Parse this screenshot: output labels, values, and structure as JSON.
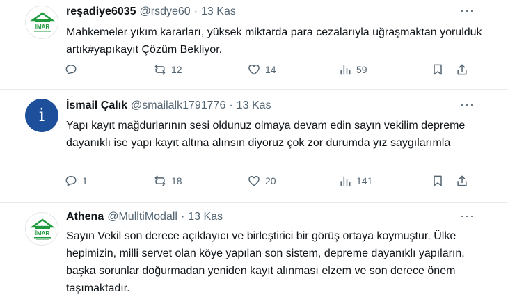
{
  "tweets": [
    {
      "name": "reşadiye6035",
      "handle": "@rsdye60",
      "separator": "·",
      "date": "13 Kas",
      "more": "···",
      "avatar_text": "İMAR",
      "text": "Mahkemeler yıkım kararları, yüksek miktarda para cezalarıyla uğraşmaktan yorulduk artık#yapıkayıt Çözüm Bekliyor.",
      "replies": "",
      "retweets": "12",
      "likes": "14",
      "views": "59"
    },
    {
      "name": "İsmail Çalık",
      "handle": "@smailalk1791776",
      "separator": "·",
      "date": "13 Kas",
      "more": "···",
      "avatar_text": "i",
      "text": "Yapı kayıt mağdurlarının sesi oldunuz olmaya devam edin sayın vekilim depreme dayanıklı ise yapı kayıt altına alınsın diyoruz çok zor durumda yız saygılarımla",
      "replies": "1",
      "retweets": "18",
      "likes": "20",
      "views": "141"
    },
    {
      "name": "Athena",
      "handle": "@MulltiModall",
      "separator": "·",
      "date": "13 Kas",
      "more": "···",
      "avatar_text": "İMAR",
      "text": "Sayın Vekil son derece açıklayıcı ve birleştirici bir görüş ortaya koymuştur. Ülke hepimizin, milli servet olan köye yapılan son sistem, depreme dayanıklı yapıların, başka sorunlar doğurmadan yeniden kayıt alınması elzem ve son derece önem taşımaktadır."
    }
  ],
  "colors": {
    "text": "#0f1419",
    "muted": "#536471",
    "divider": "#e6ecf0",
    "imar_green": "#1e9a3e",
    "avatar_blue": "#1d4f9a"
  }
}
